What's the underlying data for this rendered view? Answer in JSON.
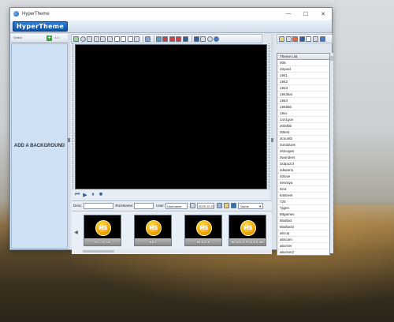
{
  "window": {
    "title": "HyperTheme"
  },
  "titlebar": {
    "minimize": "—",
    "maximize": "☐",
    "close": "✕"
  },
  "menubar": {
    "logo_text": "HyperTheme"
  },
  "left_panel": {
    "select_value": "Select",
    "add_icon": "+",
    "add_label": "Add",
    "background_text": "ADD A BACKGROUND"
  },
  "player": {
    "prev": "⏮",
    "play": "▶",
    "pause": "⏸",
    "stop": "■"
  },
  "info_bar": {
    "desc_label": "Desc:",
    "desc_value": "",
    "romname_label": "RomName:",
    "romname_value": "",
    "user_label": "User:",
    "user_value": "Username",
    "date_value": "2020.10.21",
    "game_select": "Game"
  },
  "thumbnails": [
    {
      "logo": "HS",
      "caption": "Arc Grow"
    },
    {
      "logo": "HS",
      "caption": "Blur"
    },
    {
      "logo": "HS",
      "caption": "Bounce"
    },
    {
      "logo": "HS",
      "caption": "Bounce Around 3D"
    }
  ],
  "theme_list": {
    "header": "Theme List",
    "items": [
      "005",
      "10yard",
      "1941",
      "1942",
      "1943",
      "1943kai",
      "1944",
      "1945kiii",
      "19xx",
      "1on1gov",
      "2020bb",
      "30test",
      "3countb",
      "3on3dunk",
      "3stooges",
      "3wonders",
      "3x3puzzl",
      "4dwarrio",
      "40love",
      "4enraya",
      "4in1",
      "64street",
      "720",
      "7jigen",
      "88games",
      "8ballact",
      "8ballact2",
      "abcop",
      "abscam",
      "aburner",
      "aburner2"
    ]
  },
  "icons": {
    "main_toolbar": [
      "folder-icon",
      "circle-icon",
      "cube-icon",
      "globe-icon",
      "gear-icon",
      "film-icon",
      "image-icon",
      "frame-icon",
      "plus-icon",
      "slider-icon",
      "user-icon",
      "image-edit-icon",
      "car-icon",
      "car-icon",
      "car-icon",
      "film-icon",
      "save-icon",
      "copy-icon",
      "settings-icon",
      "help-icon"
    ],
    "right_toolbar": [
      "folder-icon",
      "brush-icon",
      "color-icon",
      "window-icon",
      "search-icon",
      "wrench-icon",
      "refresh-icon"
    ]
  }
}
